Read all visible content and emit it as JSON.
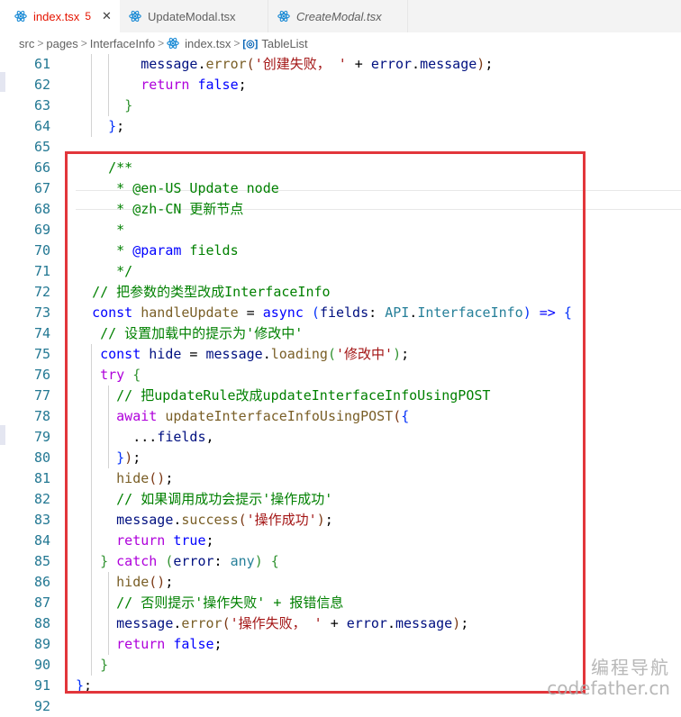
{
  "tabs": [
    {
      "label": "index.tsx",
      "badge": "5",
      "close": "✕",
      "active": true
    },
    {
      "label": "UpdateModal.tsx",
      "active": false
    },
    {
      "label": "CreateModal.tsx",
      "active": false,
      "italic": true
    }
  ],
  "breadcrumb": {
    "items": [
      "src",
      "pages",
      "InterfaceInfo",
      "index.tsx",
      "TableList"
    ],
    "separator": ">"
  },
  "watermark": {
    "line1": "编程导航",
    "line2": "codefather.cn"
  },
  "colors": {
    "keyword": "#0000ff",
    "control": "#af00db",
    "string": "#a31515",
    "comment": "#008000",
    "function": "#795e26",
    "variable": "#001080",
    "type": "#267f99",
    "line_number": "#237893",
    "highlight_box": "#e2363b"
  },
  "code_lines": [
    {
      "n": "61",
      "tokens": [
        [
          "",
          "        "
        ],
        [
          "c-var",
          "message"
        ],
        [
          "",
          "."
        ],
        [
          "c-fn",
          "error"
        ],
        [
          "c-b3",
          "("
        ],
        [
          "c-str",
          "'创建失败， '"
        ],
        [
          "",
          " + "
        ],
        [
          "c-var",
          "error"
        ],
        [
          "",
          "."
        ],
        [
          "c-var",
          "message"
        ],
        [
          "c-b3",
          ")"
        ],
        [
          "",
          ";"
        ]
      ]
    },
    {
      "n": "62",
      "tokens": [
        [
          "",
          "        "
        ],
        [
          "c-ctl",
          "return"
        ],
        [
          "",
          " "
        ],
        [
          "c-kw",
          "false"
        ],
        [
          "",
          ";"
        ]
      ]
    },
    {
      "n": "63",
      "tokens": [
        [
          "",
          "      "
        ],
        [
          "c-b2",
          "}"
        ]
      ]
    },
    {
      "n": "64",
      "tokens": [
        [
          "",
          "    "
        ],
        [
          "c-b1",
          "}"
        ],
        [
          "",
          ";"
        ]
      ]
    },
    {
      "n": "65",
      "tokens": []
    },
    {
      "n": "66",
      "tokens": [
        [
          "",
          "    "
        ],
        [
          "c-cmt",
          "/**"
        ]
      ]
    },
    {
      "n": "67",
      "tokens": [
        [
          "",
          "     "
        ],
        [
          "c-cmt",
          "* @en-US Update node"
        ]
      ]
    },
    {
      "n": "68",
      "tokens": [
        [
          "",
          "     "
        ],
        [
          "c-cmt",
          "* @zh-CN 更新节点"
        ]
      ]
    },
    {
      "n": "69",
      "tokens": [
        [
          "",
          "     "
        ],
        [
          "c-cmt",
          "*"
        ]
      ]
    },
    {
      "n": "70",
      "tokens": [
        [
          "",
          "     "
        ],
        [
          "c-cmt",
          "* "
        ],
        [
          "c-kw",
          "@param"
        ],
        [
          "c-cmt",
          " fields"
        ]
      ]
    },
    {
      "n": "71",
      "tokens": [
        [
          "",
          "     "
        ],
        [
          "c-cmt",
          "*/"
        ]
      ]
    },
    {
      "n": "72",
      "tokens": [
        [
          "",
          "  "
        ],
        [
          "c-cmt",
          "// 把参数的类型改成InterfaceInfo"
        ]
      ]
    },
    {
      "n": "73",
      "tokens": [
        [
          "",
          "  "
        ],
        [
          "c-kw",
          "const"
        ],
        [
          "",
          " "
        ],
        [
          "c-fn",
          "handleUpdate"
        ],
        [
          "",
          " = "
        ],
        [
          "c-kw",
          "async"
        ],
        [
          "",
          " "
        ],
        [
          "c-b1",
          "("
        ],
        [
          "c-var",
          "fields"
        ],
        [
          "",
          ": "
        ],
        [
          "c-type",
          "API"
        ],
        [
          "",
          "."
        ],
        [
          "c-type",
          "InterfaceInfo"
        ],
        [
          "c-b1",
          ")"
        ],
        [
          "",
          " "
        ],
        [
          "c-kw",
          "=>"
        ],
        [
          "",
          " "
        ],
        [
          "c-b1",
          "{"
        ]
      ]
    },
    {
      "n": "74",
      "tokens": [
        [
          "",
          "   "
        ],
        [
          "c-cmt",
          "// 设置加载中的提示为'修改中'"
        ]
      ]
    },
    {
      "n": "75",
      "tokens": [
        [
          "",
          "   "
        ],
        [
          "c-kw",
          "const"
        ],
        [
          "",
          " "
        ],
        [
          "c-var",
          "hide"
        ],
        [
          "",
          " = "
        ],
        [
          "c-var",
          "message"
        ],
        [
          "",
          "."
        ],
        [
          "c-fn",
          "loading"
        ],
        [
          "c-b2",
          "("
        ],
        [
          "c-str",
          "'修改中'"
        ],
        [
          "c-b2",
          ")"
        ],
        [
          "",
          ";"
        ]
      ]
    },
    {
      "n": "76",
      "tokens": [
        [
          "",
          "   "
        ],
        [
          "c-ctl",
          "try"
        ],
        [
          "",
          " "
        ],
        [
          "c-b2",
          "{"
        ]
      ]
    },
    {
      "n": "77",
      "tokens": [
        [
          "",
          "     "
        ],
        [
          "c-cmt",
          "// 把updateRule改成updateInterfaceInfoUsingPOST"
        ]
      ]
    },
    {
      "n": "78",
      "tokens": [
        [
          "",
          "     "
        ],
        [
          "c-ctl",
          "await"
        ],
        [
          "",
          " "
        ],
        [
          "c-fn",
          "updateInterfaceInfoUsingPOST"
        ],
        [
          "c-b3",
          "("
        ],
        [
          "c-b1",
          "{"
        ]
      ]
    },
    {
      "n": "79",
      "tokens": [
        [
          "",
          "       ..."
        ],
        [
          "c-var",
          "fields"
        ],
        [
          "",
          ","
        ]
      ]
    },
    {
      "n": "80",
      "tokens": [
        [
          "",
          "     "
        ],
        [
          "c-b1",
          "}"
        ],
        [
          "c-b3",
          ")"
        ],
        [
          "",
          ";"
        ]
      ]
    },
    {
      "n": "81",
      "tokens": [
        [
          "",
          "     "
        ],
        [
          "c-fn",
          "hide"
        ],
        [
          "c-b3",
          "()"
        ],
        [
          "",
          ";"
        ]
      ]
    },
    {
      "n": "82",
      "tokens": [
        [
          "",
          "     "
        ],
        [
          "c-cmt",
          "// 如果调用成功会提示'操作成功'"
        ]
      ]
    },
    {
      "n": "83",
      "tokens": [
        [
          "",
          "     "
        ],
        [
          "c-var",
          "message"
        ],
        [
          "",
          "."
        ],
        [
          "c-fn",
          "success"
        ],
        [
          "c-b3",
          "("
        ],
        [
          "c-str",
          "'操作成功'"
        ],
        [
          "c-b3",
          ")"
        ],
        [
          "",
          ";"
        ]
      ]
    },
    {
      "n": "84",
      "tokens": [
        [
          "",
          "     "
        ],
        [
          "c-ctl",
          "return"
        ],
        [
          "",
          " "
        ],
        [
          "c-kw",
          "true"
        ],
        [
          "",
          ";"
        ]
      ]
    },
    {
      "n": "85",
      "tokens": [
        [
          "",
          "   "
        ],
        [
          "c-b2",
          "}"
        ],
        [
          "",
          " "
        ],
        [
          "c-ctl",
          "catch"
        ],
        [
          "",
          " "
        ],
        [
          "c-b2",
          "("
        ],
        [
          "c-var",
          "error"
        ],
        [
          "",
          ": "
        ],
        [
          "c-type",
          "any"
        ],
        [
          "c-b2",
          ")"
        ],
        [
          "",
          " "
        ],
        [
          "c-b2",
          "{"
        ]
      ]
    },
    {
      "n": "86",
      "tokens": [
        [
          "",
          "     "
        ],
        [
          "c-fn",
          "hide"
        ],
        [
          "c-b3",
          "()"
        ],
        [
          "",
          ";"
        ]
      ]
    },
    {
      "n": "87",
      "tokens": [
        [
          "",
          "     "
        ],
        [
          "c-cmt",
          "// 否则提示'操作失败' + 报错信息"
        ]
      ]
    },
    {
      "n": "88",
      "tokens": [
        [
          "",
          "     "
        ],
        [
          "c-var",
          "message"
        ],
        [
          "",
          "."
        ],
        [
          "c-fn",
          "error"
        ],
        [
          "c-b3",
          "("
        ],
        [
          "c-str",
          "'操作失败， '"
        ],
        [
          "",
          " + "
        ],
        [
          "c-var",
          "error"
        ],
        [
          "",
          "."
        ],
        [
          "c-var",
          "message"
        ],
        [
          "c-b3",
          ")"
        ],
        [
          "",
          ";"
        ]
      ]
    },
    {
      "n": "89",
      "tokens": [
        [
          "",
          "     "
        ],
        [
          "c-ctl",
          "return"
        ],
        [
          "",
          " "
        ],
        [
          "c-kw",
          "false"
        ],
        [
          "",
          ";"
        ]
      ]
    },
    {
      "n": "90",
      "tokens": [
        [
          "",
          "   "
        ],
        [
          "c-b2",
          "}"
        ]
      ]
    },
    {
      "n": "91",
      "tokens": [
        [
          "",
          ""
        ],
        [
          "c-b1",
          "}"
        ],
        [
          "",
          ";"
        ]
      ]
    },
    {
      "n": "92",
      "tokens": []
    }
  ]
}
